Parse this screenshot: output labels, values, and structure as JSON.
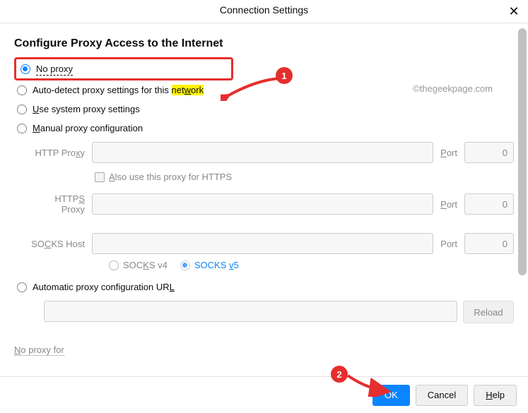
{
  "header": {
    "title": "Connection Settings"
  },
  "section_title": "Configure Proxy Access to the Internet",
  "options": {
    "no_proxy": "No proxy",
    "auto_detect_pre": "Auto-detect proxy settings for this ",
    "auto_detect_hl_pre": "net",
    "auto_detect_hl_u": "w",
    "auto_detect_hl_post": "ork",
    "use_system_pre": "U",
    "use_system_post": "se system proxy settings",
    "manual_pre": "M",
    "manual_post": "anual proxy configuration",
    "auto_url_pre": "Automatic proxy configuration UR",
    "auto_url_post": "L"
  },
  "labels": {
    "http_pre": "HTTP Pro",
    "http_u": "x",
    "http_post": "y",
    "https_pre": "HTTP",
    "https_u": "S",
    "https_post": " Proxy",
    "socks_pre": "SO",
    "socks_u": "C",
    "socks_post": "KS Host",
    "port_pre": "P",
    "port_post": "ort",
    "port_plain": "Port",
    "also_https_pre": "A",
    "also_https_post": "lso use this proxy for HTTPS",
    "socks4_pre": "SOC",
    "socks4_u": "K",
    "socks4_post": "S v4",
    "socks5_pre": "SOCKS ",
    "socks5_u": "v",
    "socks5_post": "5",
    "reload": "Reload",
    "no_proxy_for_pre": "N",
    "no_proxy_for_post": "o proxy for"
  },
  "values": {
    "port0": "0"
  },
  "buttons": {
    "ok": "OK",
    "cancel": "Cancel",
    "help_pre": "H",
    "help_post": "elp"
  },
  "annotations": {
    "a1": "1",
    "a2": "2"
  },
  "watermark": "©thegeekpage.com"
}
